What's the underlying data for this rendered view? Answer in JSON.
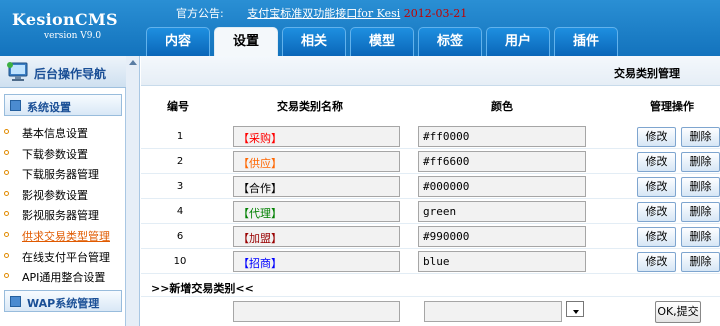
{
  "header": {
    "app_name": "KesionCMS",
    "version": "version V9.0",
    "notice_label": "官方公告:",
    "notice_text": "支付宝标准双功能接口for Kesi",
    "notice_date": "2012-03-21"
  },
  "tabs": [
    "内容",
    "设置",
    "相关",
    "模型",
    "标签",
    "用户",
    "插件"
  ],
  "active_tab": "设置",
  "sidebar": {
    "title": "后台操作导航",
    "groups": [
      {
        "label": "系统设置"
      },
      {
        "label": "WAP系统管理"
      }
    ],
    "items": [
      {
        "label": "基本信息设置"
      },
      {
        "label": "下载参数设置"
      },
      {
        "label": "下载服务器管理"
      },
      {
        "label": "影视参数设置"
      },
      {
        "label": "影视服务器管理"
      },
      {
        "label": "供求交易类型管理"
      },
      {
        "label": "在线支付平台管理"
      },
      {
        "label": "API通用整合设置"
      }
    ],
    "active_item": "供求交易类型管理"
  },
  "page": {
    "title": "交易类别管理",
    "columns": [
      "编号",
      "交易类别名称",
      "颜色",
      "管理操作"
    ],
    "rows": [
      {
        "id": "1",
        "name": "【采购】",
        "color": "#ff0000"
      },
      {
        "id": "2",
        "name": "【供应】",
        "color": "#ff6600"
      },
      {
        "id": "3",
        "name": "【合作】",
        "color": "#000000"
      },
      {
        "id": "4",
        "name": "【代理】",
        "color": "green"
      },
      {
        "id": "6",
        "name": "【加盟】",
        "color": "#990000"
      },
      {
        "id": "10",
        "name": "【招商】",
        "color": "blue"
      }
    ],
    "edit_label": "修改",
    "delete_label": "删除",
    "new_section_label": ">>新增交易类别<<",
    "new_name_value": "",
    "new_color_value": "",
    "ok_label": "OK,提交"
  },
  "colors": {
    "header_blue": "#1373bd",
    "accent_orange": "#e05a00",
    "notice_date_red": "#c00000"
  }
}
